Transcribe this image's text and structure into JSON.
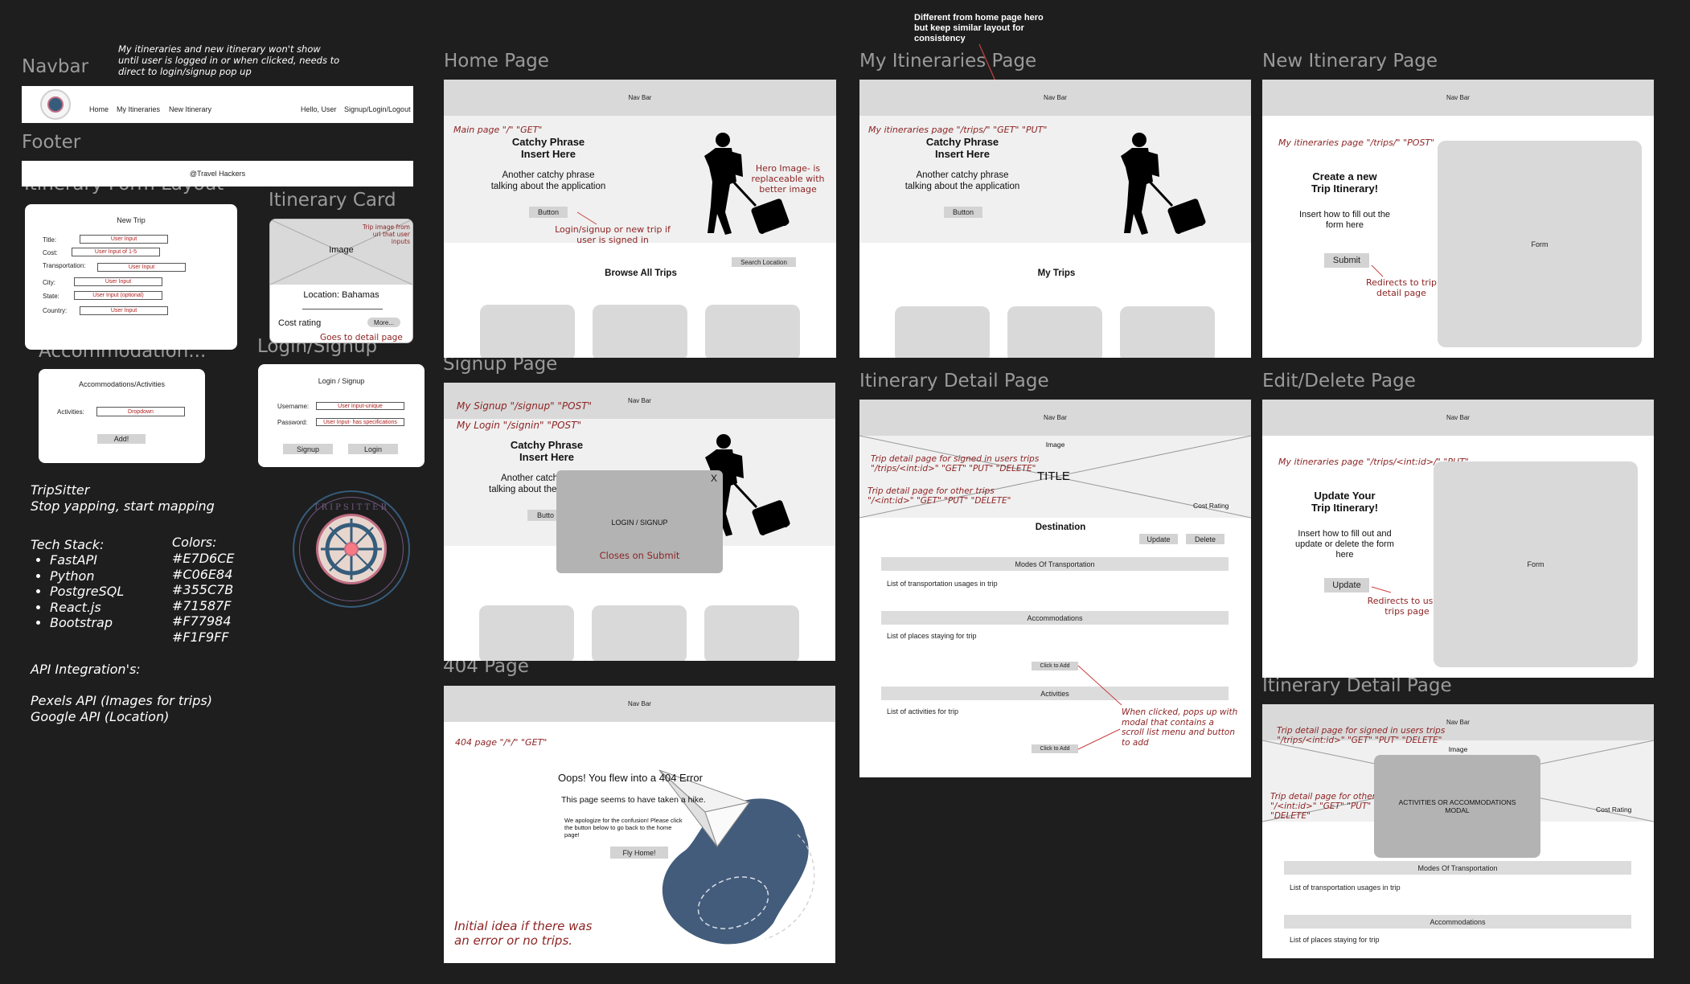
{
  "labels": {
    "navbar": "Navbar",
    "footer": "Footer",
    "itinerary_form_layout": "Itinerary Form Layout",
    "itinerary_card": "Itinerary Card",
    "accommodation": "Accommodation...",
    "login_signup": "Login/Signup",
    "home_page": "Home Page",
    "my_itineraries_page": "My Itineraries Page",
    "new_itinerary_page": "New Itinerary Page",
    "signup_page": "Signup Page",
    "itinerary_detail_page": "Itinerary Detail Page",
    "edit_delete_page": "Edit/Delete Page",
    "page_404": "404 Page",
    "itinerary_detail_page_2": "Itinerary Detail Page"
  },
  "notes": {
    "navbar_note": "My itineraries and new itinerary won't show until user is logged in or when clicked, needs to direct to login/signup pop up",
    "hero_note": "Different from home page hero but keep similar layout for consistency"
  },
  "navbar_mock": {
    "links": [
      "Home",
      "My Itineraries",
      "New Itinerary"
    ],
    "greeting": "Hello, User",
    "auth": "Signup/Login/Logout"
  },
  "footer_mock": {
    "text": "@Travel Hackers"
  },
  "form_layout": {
    "title": "New Trip",
    "fields": [
      {
        "label": "Title:",
        "value": "User Input"
      },
      {
        "label": "Cost:",
        "value": "User Input of 1-5"
      },
      {
        "label": "Transportation:",
        "value": "User Input"
      },
      {
        "label": "City:",
        "value": "User Input"
      },
      {
        "label": "State:",
        "value": "User Input (optional)"
      },
      {
        "label": "Country:",
        "value": "User Input"
      }
    ]
  },
  "card": {
    "image_note": "Trip image from url that user inputs",
    "image": "Image",
    "location": "Location: Bahamas",
    "cost": "Cost rating",
    "more": "More...",
    "more_note": "Goes to detail page"
  },
  "accom_mock": {
    "title": "Accommodations/Activities",
    "label": "Activities:",
    "value": "Dropdown",
    "button": "Add!"
  },
  "login_mock": {
    "title": "Login / Signup",
    "username_label": "Username:",
    "username_value": "User Input-unique",
    "password_label": "Password:",
    "password_value": "User Input- has specifications",
    "signup": "Signup",
    "login": "Login"
  },
  "project": {
    "name": "TripSitter",
    "tagline": "Stop yapping, start mapping",
    "tech_title": "Tech Stack:",
    "tech": [
      "FastAPI",
      "Python",
      "PostgreSQL",
      "React.js",
      "Bootstrap"
    ],
    "colors_title": "Colors:",
    "colors": [
      "#E7D6CE",
      "#C06E84",
      "#355C7B",
      "#71587F",
      "#F77984",
      "#F1F9FF"
    ],
    "api_title": "API Integration's:",
    "apis": [
      "Pexels API (Images for trips)",
      "Google API (Location)"
    ],
    "logo_text": "TRIPSITTER"
  },
  "common": {
    "nav_bar": "Nav Bar",
    "catchy1": "Catchy Phrase",
    "catchy2": "Insert Here",
    "sub1": "Another catchy phrase",
    "sub2": "talking about the application",
    "button": "Button"
  },
  "home": {
    "route": "Main page  \"/\"  \"GET\"",
    "hero_note": "Hero Image- is replaceable with better image",
    "button_note": "Login/signup or new trip if user is signed in",
    "search": "Search Location",
    "browse": "Browse All Trips"
  },
  "myitin": {
    "route": "My itineraries page  \"/trips/\"  \"GET\"  \"PUT\"",
    "section": "My Trips"
  },
  "newitin": {
    "route": "My itineraries page  \"/trips/\" \"POST\"",
    "h1": "Create a new",
    "h2": "Trip Itinerary!",
    "body": "Insert how to fill out the form here",
    "submit": "Submit",
    "form": "Form",
    "note": "Redirects to trip detail page"
  },
  "signup": {
    "route1": "My Signup   \"/signup\"  \"POST\"",
    "route2": "My Login    \"/signin\"  \"POST\"",
    "modal_close": "X",
    "modal_title": "LOGIN / SIGNUP",
    "modal_note": "Closes on Submit",
    "partial1": "Another catch",
    "partial2": "talking about the",
    "button_partial": "Butto"
  },
  "detail": {
    "image": "Image",
    "note1": "Trip detail page for signed in users trips \"/trips/<int:id>\"  \"GET\"  \"PUT\"  \"DELETE\"",
    "note2": "Trip detail page for other trips \"/<int:id>\"  \"GET\"  \"PUT\"  \"DELETE\"",
    "title": "TITLE",
    "cost": "Cost Rating",
    "destination": "Destination",
    "update": "Update",
    "delete": "Delete",
    "transport": "Modes Of Transportation",
    "transport_list": "List of transportation usages in trip",
    "accom": "Accommodations",
    "accom_list": "List of places staying for trip",
    "click_add": "Click to Add",
    "activities": "Activities",
    "activities_list": "List of activities for trip",
    "popup_note": "When clicked, pops up with modal that contains a scroll list menu and button to add"
  },
  "edit": {
    "route": "My itineraries page  \"/trips/<int:id>/\" \"PUT\"",
    "h1": "Update Your",
    "h2": "Trip Itinerary!",
    "body": "Insert how to fill out and update or delete the form here",
    "update": "Update",
    "form": "Form",
    "note": "Redirects to users trips page"
  },
  "p404": {
    "route": "404 page  \"/*/\"  \"GET\"",
    "h": "Oops! You flew into a 404 Error",
    "sub": "This page seems to have taken a hike.",
    "apology": "We apologize for the confusion! Please click the button below to go back to the home page!",
    "button": "Fly Home!",
    "idea": "Initial idea if there was an error or no trips."
  },
  "detail2": {
    "note1": "Trip detail page for signed in users trips \"/trips/<int:id>\"  \"GET\"  \"PUT\"  \"DELETE\"",
    "note2": "Trip detail page for other \"/<int:id>\"  \"GET\"  \"PUT\"  \"DELETE\"",
    "image": "Image",
    "modal": "ACTIVITIES OR ACCOMMODATIONS MODAL",
    "cost": "Cost Rating",
    "transport": "Modes Of Transportation",
    "transport_list": "List of transportation usages in trip",
    "accom": "Accommodations",
    "accom_list": "List of places staying for trip"
  }
}
